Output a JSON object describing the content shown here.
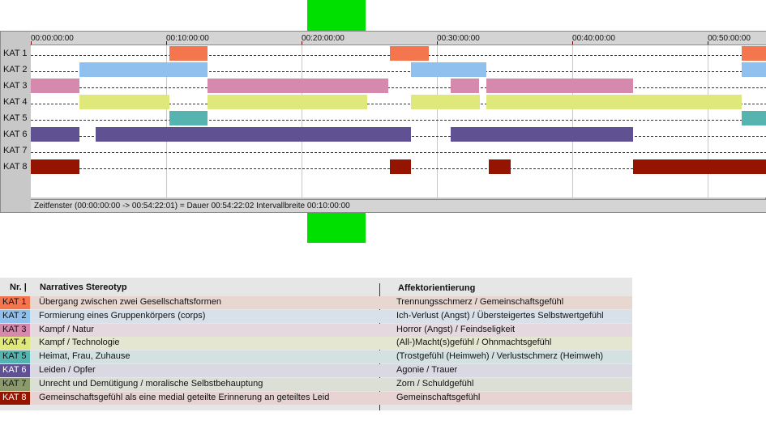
{
  "timeline": {
    "duration_ms": 3262020,
    "ticks": [
      "00:00:00:00",
      "00:10:00:00",
      "00:20:00:00",
      "00:30:00:00",
      "00:40:00:00",
      "00:50:00:00"
    ],
    "tick_step_ms": 600000,
    "status": "Zeitfenster (00:00:00:00 -> 00:54:22:01) = Dauer 00:54:22:02    Intervallbreite 00:10:00:00",
    "categories": [
      {
        "label": "KAT 1",
        "color": "#f4764f",
        "segments": [
          [
            616000,
            783000
          ],
          [
            1593000,
            1764000
          ],
          [
            3150000,
            3262020
          ]
        ]
      },
      {
        "label": "KAT 2",
        "color": "#8fc0ee",
        "segments": [
          [
            216000,
            783000
          ],
          [
            1685000,
            2020000
          ],
          [
            3150000,
            3262020
          ]
        ]
      },
      {
        "label": "KAT 3",
        "color": "#d589ad",
        "segments": [
          [
            0,
            216000
          ],
          [
            783000,
            1585000
          ],
          [
            1861000,
            1985000
          ],
          [
            2020000,
            2671000
          ]
        ]
      },
      {
        "label": "KAT 4",
        "color": "#dfe87a",
        "segments": [
          [
            216000,
            616000
          ],
          [
            783000,
            1490000
          ],
          [
            1685000,
            1992000
          ],
          [
            2020000,
            3150000
          ]
        ]
      },
      {
        "label": "KAT 5",
        "color": "#56b4b0",
        "segments": [
          [
            616000,
            783000
          ],
          [
            3150000,
            3262020
          ]
        ]
      },
      {
        "label": "KAT 6",
        "color": "#5f5192",
        "segments": [
          [
            0,
            216000
          ],
          [
            287000,
            1685000
          ],
          [
            1861000,
            2671000
          ]
        ]
      },
      {
        "label": "KAT 7",
        "color": "#8a9a6a",
        "segments": []
      },
      {
        "label": "KAT 8",
        "color": "#941400",
        "segments": [
          [
            0,
            216000
          ],
          [
            1593000,
            1685000
          ],
          [
            2029000,
            2126000
          ],
          [
            2671000,
            3262020
          ]
        ]
      }
    ]
  },
  "legend": {
    "header_nr": "Nr. |",
    "header_stereotype": "Narratives Stereotyp",
    "header_affect": "Affektorientierung",
    "rows": [
      {
        "code": "KAT 1",
        "color": "#f4764f",
        "tint": "#e8d6d1",
        "stereotype": "Übergang zwischen zwei Gesellschaftsformen",
        "affect": "Trennungsschmerz / Gemeinschaftsgefühl"
      },
      {
        "code": "KAT 2",
        "color": "#8fc0ee",
        "tint": "#d8e1ea",
        "stereotype": "Formierung eines Gruppenkörpers (corps)",
        "affect": "Ich-Verlust (Angst) / Übersteigertes Selbstwertgefühl"
      },
      {
        "code": "KAT 3",
        "color": "#d589ad",
        "tint": "#e6d8df",
        "stereotype": "Kampf / Natur",
        "affect": "Horror (Angst) / Feindseligkeit"
      },
      {
        "code": "KAT 4",
        "color": "#dfe87a",
        "tint": "#e4e6d2",
        "stereotype": "Kampf / Technologie",
        "affect": "(All-)Macht(s)gefühl / Ohnmachtsgefühl"
      },
      {
        "code": "KAT 5",
        "color": "#56b4b0",
        "tint": "#d3e2e1",
        "stereotype": "Heimat, Frau, Zuhause",
        "affect": "(Trostgefühl (Heimweh) / Verlustschmerz (Heimweh)"
      },
      {
        "code": "KAT 6",
        "color": "#5f5192",
        "tint": "#dad8e2",
        "stereotype": "Leiden / Opfer",
        "affect": "Agonie / Trauer"
      },
      {
        "code": "KAT 7",
        "color": "#8a9a6a",
        "tint": "#dcdfd6",
        "stereotype": "Unrecht und Demütigung / moralische Selbstbehauptung",
        "affect": "Zorn / Schuldgefühl"
      },
      {
        "code": "KAT 8",
        "color": "#941400",
        "tint": "#e6d3d2",
        "stereotype": "Gemeinschaftsgefühl als eine medial geteilte Erinnerung an geteiltes Leid",
        "affect": "Gemeinschaftsgefühl"
      }
    ]
  }
}
